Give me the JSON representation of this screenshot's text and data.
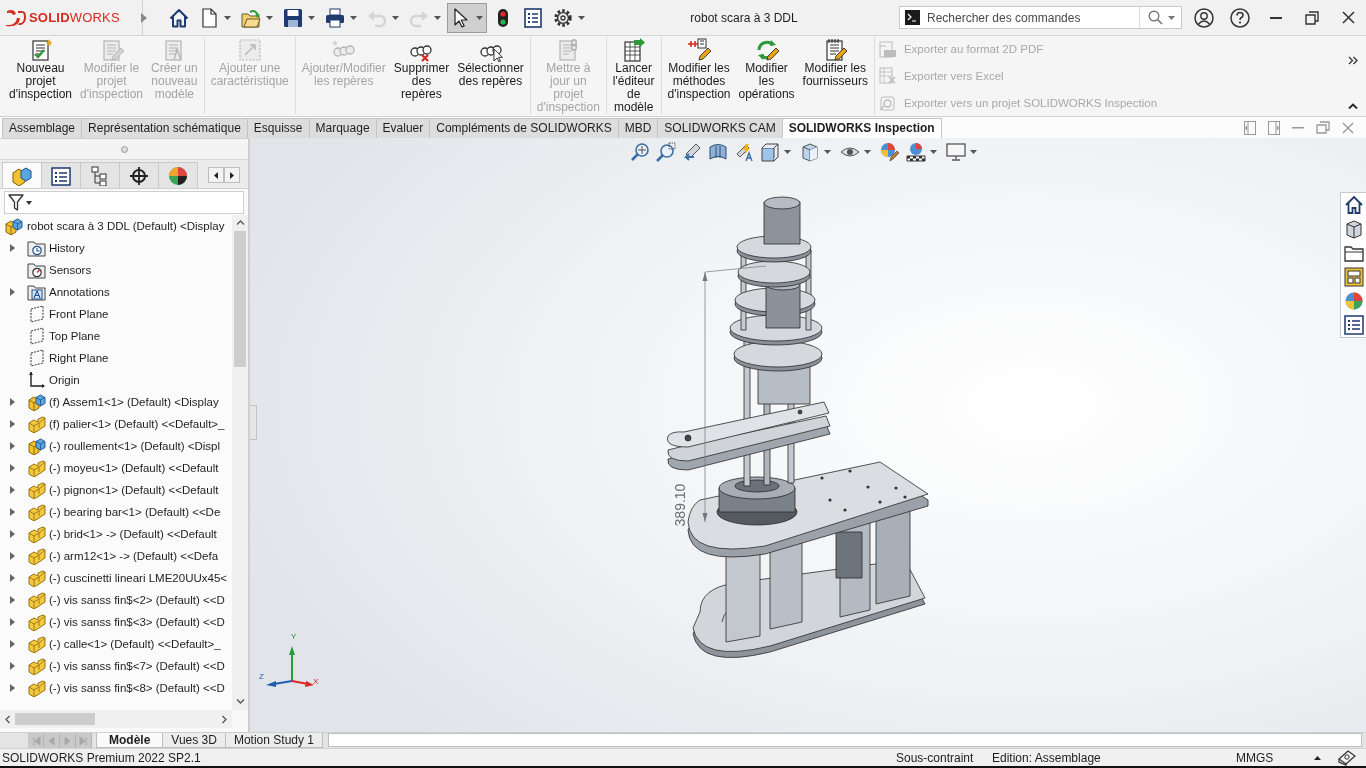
{
  "app": {
    "logo": "**SOLID**WORKS",
    "title": "robot scara à 3 DDL"
  },
  "quick_access": [
    {
      "dropdown": false,
      "disabled": false,
      "selected": false
    },
    {
      "dropdown": true,
      "disabled": false,
      "selected": false
    },
    {
      "dropdown": true,
      "disabled": false,
      "selected": false
    },
    {
      "dropdown": true,
      "disabled": false,
      "selected": false
    },
    {
      "dropdown": true,
      "disabled": false,
      "selected": false
    },
    {
      "dropdown": true,
      "disabled": true,
      "selected": false
    },
    {
      "dropdown": true,
      "disabled": true,
      "selected": false
    },
    {
      "dropdown": true,
      "disabled": false,
      "selected": true
    },
    {
      "dropdown": false,
      "disabled": false,
      "selected": false
    },
    {
      "dropdown": false,
      "disabled": false,
      "selected": false
    },
    {
      "dropdown": true,
      "disabled": false,
      "selected": false
    }
  ],
  "search": {
    "placeholder": "Rechercher des commandes"
  },
  "ribbon": {
    "groups": [
      {
        "buttons": [
          {
            "label": "Nouveau\nprojet\nd'inspection",
            "disabled": false
          },
          {
            "label": "Modifier le\nprojet\nd'inspection",
            "disabled": true
          },
          {
            "label": "Créer un\nnouveau\nmodèle",
            "disabled": true
          }
        ]
      },
      {
        "buttons": [
          {
            "label": "Ajouter une\ncaractéristique",
            "disabled": true
          }
        ]
      },
      {
        "buttons": [
          {
            "label": "Ajouter/Modifier\nles repères",
            "disabled": true
          },
          {
            "label": "Supprimer\ndes\nrepères",
            "disabled": false
          },
          {
            "label": "Sélectionner\ndes repères",
            "disabled": false
          }
        ]
      },
      {
        "buttons": [
          {
            "label": "Mettre à\njour un\nprojet\nd'inspection",
            "disabled": true
          }
        ]
      },
      {
        "buttons": [
          {
            "label": "Lancer\nl'éditeur\nde\nmodèle",
            "disabled": false
          }
        ]
      },
      {
        "buttons": [
          {
            "label": "Modifier les\nméthodes\nd'inspection",
            "disabled": false
          },
          {
            "label": "Modifier\nles\nopérations",
            "disabled": false
          },
          {
            "label": "Modifier les\nfournisseurs",
            "disabled": false
          }
        ]
      }
    ],
    "export_items": [
      {
        "label": "Exporter au format 2D PDF",
        "disabled": true
      },
      {
        "label": "Exporter vers Excel",
        "disabled": true
      },
      {
        "label": "Exporter vers un projet SOLIDWORKS Inspection",
        "disabled": true
      }
    ]
  },
  "ribbon_tabs": [
    {
      "label": "Assemblage",
      "selected": false
    },
    {
      "label": "Représentation schématique",
      "selected": false
    },
    {
      "label": "Esquisse",
      "selected": false
    },
    {
      "label": "Marquage",
      "selected": false
    },
    {
      "label": "Evaluer",
      "selected": false
    },
    {
      "label": "Compléments de SOLIDWORKS",
      "selected": false
    },
    {
      "label": "MBD",
      "selected": false
    },
    {
      "label": "SOLIDWORKS CAM",
      "selected": false
    },
    {
      "label": "SOLIDWORKS Inspection",
      "selected": true
    }
  ],
  "panel_tabs": [
    {
      "selected": true
    },
    {
      "selected": false
    },
    {
      "selected": false
    },
    {
      "selected": false
    },
    {
      "selected": false
    }
  ],
  "tree": {
    "label": "robot scara à 3 DDL (Default) <Display",
    "kind": "assembly",
    "children": [
      {
        "label": "History",
        "kind": "history",
        "expanded": false
      },
      {
        "label": "Sensors",
        "kind": "sensors"
      },
      {
        "label": "Annotations",
        "kind": "annotations",
        "expanded": false
      },
      {
        "label": "Front Plane",
        "kind": "plane"
      },
      {
        "label": "Top Plane",
        "kind": "plane"
      },
      {
        "label": "Right Plane",
        "kind": "plane"
      },
      {
        "label": "Origin",
        "kind": "origin"
      },
      {
        "label": "(f) Assem1<1> (Default) <Display",
        "kind": "assembly",
        "expanded": false
      },
      {
        "label": "(f) palier<1> (Default) <<Default>_",
        "kind": "part",
        "expanded": false
      },
      {
        "label": "(-) roullement<1> (Default) <Displ",
        "kind": "assembly",
        "expanded": false
      },
      {
        "label": "(-) moyeu<1> (Default) <<Default",
        "kind": "part",
        "expanded": false
      },
      {
        "label": "(-) pignon<1> (Default) <<Default",
        "kind": "part",
        "expanded": false
      },
      {
        "label": "(-) bearing bar<1> (Default) <<De",
        "kind": "part",
        "expanded": false
      },
      {
        "label": "(-) brid<1> -> (Default) <<Default",
        "kind": "part",
        "expanded": false
      },
      {
        "label": "(-) arm12<1> -> (Default) <<Defa",
        "kind": "part",
        "expanded": false
      },
      {
        "label": "(-) cuscinetti lineari LME20UUx45<",
        "kind": "part",
        "expanded": false
      },
      {
        "label": "(-) vis sanss fin$<2> (Default) <<D",
        "kind": "part",
        "expanded": false
      },
      {
        "label": "(-) vis sanss fin$<3> (Default) <<D",
        "kind": "part",
        "expanded": false
      },
      {
        "label": "(-) calle<1> (Default) <<Default>_",
        "kind": "part",
        "expanded": false
      },
      {
        "label": "(-) vis sanss fin$<7> (Default) <<D",
        "kind": "part",
        "expanded": false
      },
      {
        "label": "(-) vis sanss fin$<8> (Default) <<D",
        "kind": "part",
        "expanded": false
      }
    ]
  },
  "viewport": {
    "dimension": "389.10",
    "axes": {
      "x": "X",
      "y": "Y",
      "z": "Z"
    }
  },
  "bottom_tabs": [
    {
      "label": "Modèle",
      "selected": true
    },
    {
      "label": "Vues 3D",
      "selected": false
    },
    {
      "label": "Motion Study 1",
      "selected": false
    }
  ],
  "status_bar": {
    "product": "SOLIDWORKS Premium 2022 SP2.1",
    "constraint": "Sous-contraint",
    "mode": "Edition: Assemblage",
    "units": "MMGS"
  }
}
